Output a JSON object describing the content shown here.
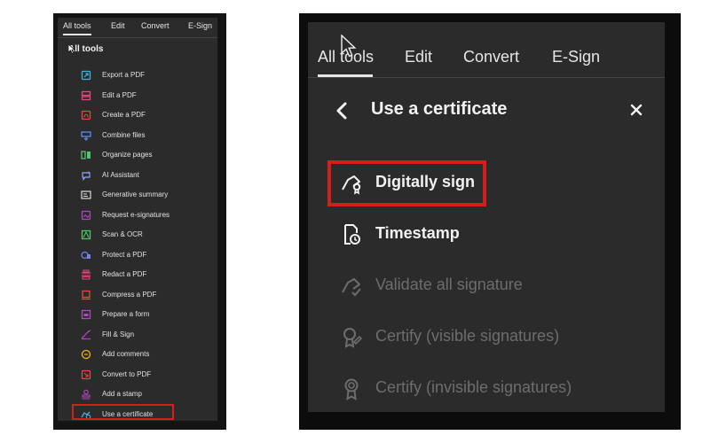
{
  "left_panel": {
    "tabs": [
      {
        "label": "All tools",
        "active": true
      },
      {
        "label": "Edit",
        "active": false
      },
      {
        "label": "Convert",
        "active": false
      },
      {
        "label": "E-Sign",
        "active": false
      }
    ],
    "heading": "All tools",
    "items": [
      {
        "label": "Export a PDF",
        "icon": "export-pdf-icon",
        "color": "#3fb3d9"
      },
      {
        "label": "Edit a PDF",
        "icon": "edit-pdf-icon",
        "color": "#e8457a"
      },
      {
        "label": "Create a PDF",
        "icon": "create-pdf-icon",
        "color": "#e84545"
      },
      {
        "label": "Combine files",
        "icon": "combine-files-icon",
        "color": "#5b8de8"
      },
      {
        "label": "Organize pages",
        "icon": "organize-pages-icon",
        "color": "#52c46c"
      },
      {
        "label": "AI Assistant",
        "icon": "ai-assistant-icon",
        "color": "#8fa8ff"
      },
      {
        "label": "Generative summary",
        "icon": "generative-summary-icon",
        "color": "#dcdcdc"
      },
      {
        "label": "Request e-signatures",
        "icon": "request-esignatures-icon",
        "color": "#b146c2"
      },
      {
        "label": "Scan & OCR",
        "icon": "scan-ocr-icon",
        "color": "#52c46c"
      },
      {
        "label": "Protect a PDF",
        "icon": "protect-pdf-icon",
        "color": "#7b7bf2"
      },
      {
        "label": "Redact a PDF",
        "icon": "redact-pdf-icon",
        "color": "#e8457a"
      },
      {
        "label": "Compress a PDF",
        "icon": "compress-pdf-icon",
        "color": "#e84545"
      },
      {
        "label": "Prepare a form",
        "icon": "prepare-form-icon",
        "color": "#b146c2"
      },
      {
        "label": "Fill & Sign",
        "icon": "fill-sign-icon",
        "color": "#b146c2"
      },
      {
        "label": "Add comments",
        "icon": "add-comments-icon",
        "color": "#f2b600"
      },
      {
        "label": "Convert to PDF",
        "icon": "convert-to-pdf-icon",
        "color": "#e84545"
      },
      {
        "label": "Add a stamp",
        "icon": "add-stamp-icon",
        "color": "#b146c2"
      },
      {
        "label": "Use a certificate",
        "icon": "use-certificate-icon",
        "color": "#3fb3d9"
      }
    ]
  },
  "right_panel": {
    "tabs": [
      {
        "label": "All tools",
        "active": true
      },
      {
        "label": "Edit",
        "active": false
      },
      {
        "label": "Convert",
        "active": false
      },
      {
        "label": "E-Sign",
        "active": false
      }
    ],
    "title": "Use a certificate",
    "back_icon": "chevron-left-icon",
    "close_icon": "close-icon",
    "items": [
      {
        "label": "Digitally sign",
        "icon": "digitally-sign-icon",
        "enabled": true,
        "highlighted": true
      },
      {
        "label": "Timestamp",
        "icon": "timestamp-icon",
        "enabled": true,
        "highlighted": false
      },
      {
        "label": "Validate all signature",
        "icon": "validate-signature-icon",
        "enabled": false,
        "highlighted": false
      },
      {
        "label": "Certify (visible signatures)",
        "icon": "certify-visible-icon",
        "enabled": false,
        "highlighted": false
      },
      {
        "label": "Certify (invisible signatures)",
        "icon": "certify-invisible-icon",
        "enabled": false,
        "highlighted": false
      }
    ]
  },
  "colors": {
    "panel_background": "#2b2b2b",
    "highlight_border": "#d51f1f",
    "text_primary": "#f2f2f2",
    "text_disabled": "#6d6d6d"
  }
}
